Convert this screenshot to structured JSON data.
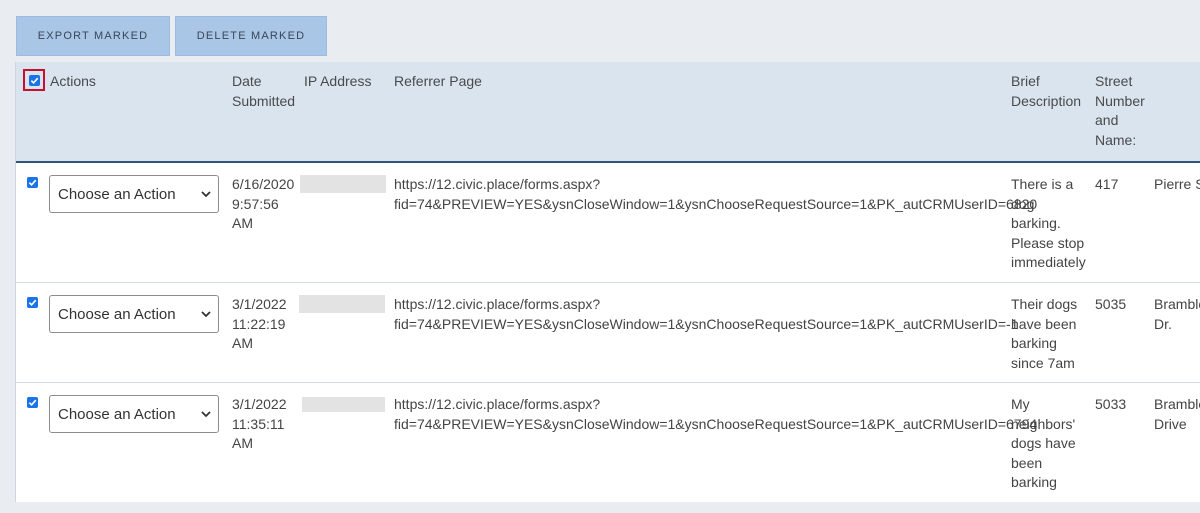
{
  "toolbar": {
    "export_label": "EXPORT MARKED",
    "delete_label": "DELETE MARKED"
  },
  "header": {
    "actions": "Actions",
    "date": [
      "Date",
      "Submitted"
    ],
    "ip": "IP Address",
    "referrer": "Referrer Page",
    "brief": [
      "Brief",
      "Description"
    ],
    "street": [
      "Street",
      "Number",
      "and",
      "Name:"
    ]
  },
  "action_placeholder": "Choose an Action",
  "rows": [
    {
      "date": [
        "6/16/2020",
        "9:57:56",
        "AM"
      ],
      "referrer": [
        "https://12.civic.place/forms.aspx?",
        "fid=74&PREVIEW=YES&ysnCloseWindow=1&ysnChooseRequestSource=1&PK_autCRMUserID=6820"
      ],
      "brief": [
        "There is a",
        "dog",
        "barking.",
        "Please stop",
        "immediately"
      ],
      "number": "417",
      "street": [
        "Pierre St"
      ]
    },
    {
      "date": [
        "3/1/2022",
        "11:22:19",
        "AM"
      ],
      "referrer": [
        "https://12.civic.place/forms.aspx?",
        "fid=74&PREVIEW=YES&ysnCloseWindow=1&ysnChooseRequestSource=1&PK_autCRMUserID=-1"
      ],
      "brief": [
        "Their dogs",
        "have been",
        "barking",
        "since 7am"
      ],
      "number": "5035",
      "street": [
        "Bramble",
        "Dr."
      ]
    },
    {
      "date": [
        "3/1/2022",
        "11:35:11",
        "AM"
      ],
      "referrer": [
        "https://12.civic.place/forms.aspx?",
        "fid=74&PREVIEW=YES&ysnCloseWindow=1&ysnChooseRequestSource=1&PK_autCRMUserID=6794"
      ],
      "brief": [
        "My",
        "neighbors'",
        "dogs have",
        "been",
        "barking"
      ],
      "number": "5033",
      "street": [
        "Bramble",
        "Drive"
      ]
    }
  ]
}
